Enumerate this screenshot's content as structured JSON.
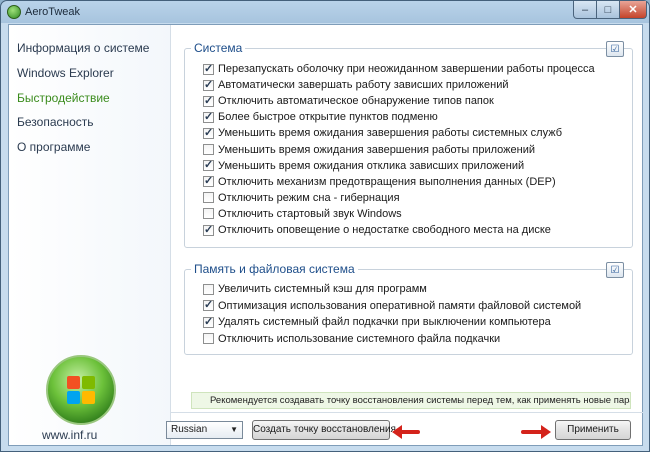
{
  "window": {
    "title": "AeroTweak"
  },
  "sidebar": {
    "items": [
      {
        "label": "Информация о системе"
      },
      {
        "label": "Windows Explorer"
      },
      {
        "label": "Быстродействие"
      },
      {
        "label": "Безопасность"
      },
      {
        "label": "О программе"
      }
    ],
    "active_index": 2,
    "site": "www.inf.ru"
  },
  "system_group": {
    "title": "Система",
    "options": [
      {
        "label": "Перезапускать оболочку при неожиданном завершении работы процесса",
        "checked": true
      },
      {
        "label": "Автоматически завершать работу зависших приложений",
        "checked": true
      },
      {
        "label": "Отключить автоматическое обнаружение типов папок",
        "checked": true
      },
      {
        "label": "Более быстрое открытие пунктов подменю",
        "checked": true
      },
      {
        "label": "Уменьшить время ожидания завершения работы системных служб",
        "checked": true
      },
      {
        "label": "Уменьшить время ожидания завершения работы приложений",
        "checked": false
      },
      {
        "label": "Уменьшить время ожидания отклика зависших приложений",
        "checked": true
      },
      {
        "label": "Отключить механизм предотвращения выполнения данных (DEP)",
        "checked": true
      },
      {
        "label": "Отключить режим сна - гибернация",
        "checked": false
      },
      {
        "label": "Отключить стартовый звук Windows",
        "checked": false
      },
      {
        "label": "Отключить оповещение о недостатке свободного места на диске",
        "checked": true
      }
    ]
  },
  "memory_group": {
    "title": "Память и файловая система",
    "options": [
      {
        "label": "Увеличить системный кэш для программ",
        "checked": false
      },
      {
        "label": "Оптимизация использования оперативной памяти файловой системой",
        "checked": true
      },
      {
        "label": "Удалять системный файл подкачки при выключении компьютера",
        "checked": true
      },
      {
        "label": "Отключить использование системного файла подкачки",
        "checked": false
      }
    ]
  },
  "notice": "Рекомендуется создавать точку восстановления системы перед тем, как применять новые параметры.",
  "footer": {
    "language": "Russian",
    "restore_button": "Создать точку восстановления",
    "apply_button": "Применить"
  },
  "colors": {
    "accent_active": "#3b8c1d",
    "group_title": "#1e4e8a",
    "arrow": "#d4231b"
  }
}
